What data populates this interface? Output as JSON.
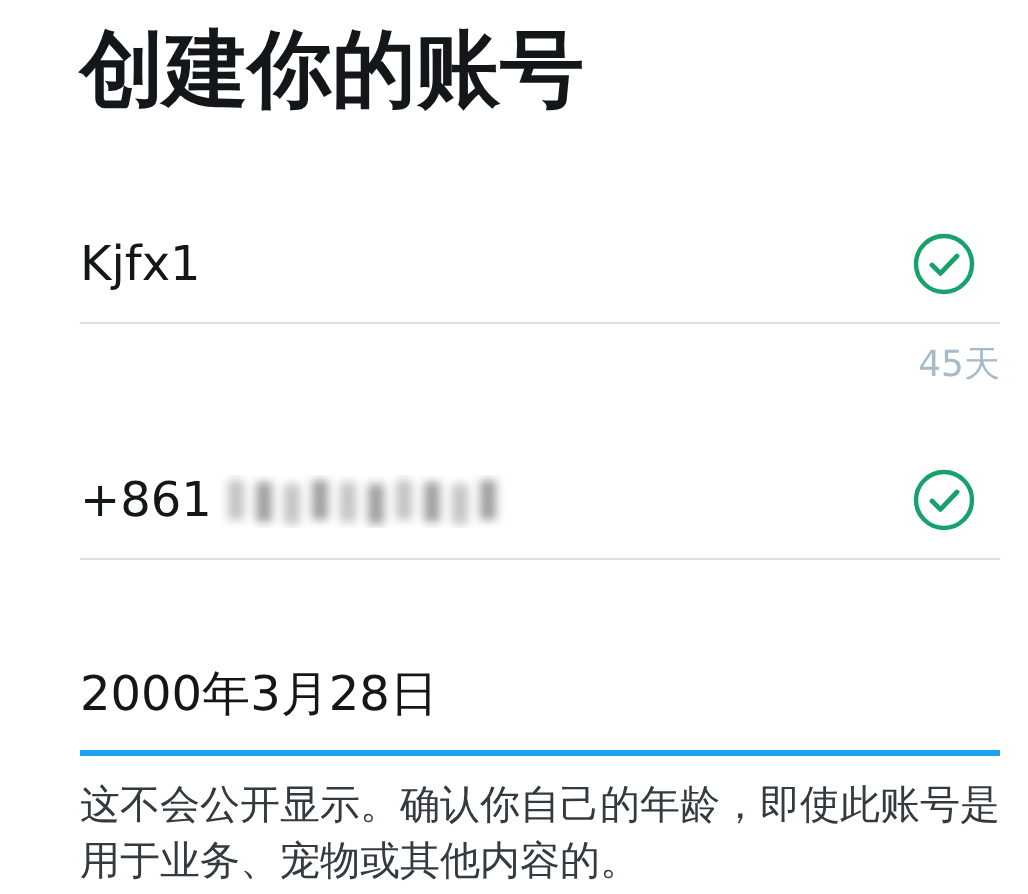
{
  "title": "创建你的账号",
  "fields": [
    {
      "value": "Kjfx1",
      "valid": true,
      "focused": false,
      "blurred_tail": false,
      "counter": "45天"
    },
    {
      "value": "+861",
      "valid": true,
      "focused": false,
      "blurred_tail": true
    },
    {
      "value": "2000年3月28日",
      "valid": false,
      "focused": true,
      "blurred_tail": false
    }
  ],
  "help_text": "这不会公开显示。确认你自己的年龄，即使此账号是用于业务、宠物或其他内容的。"
}
